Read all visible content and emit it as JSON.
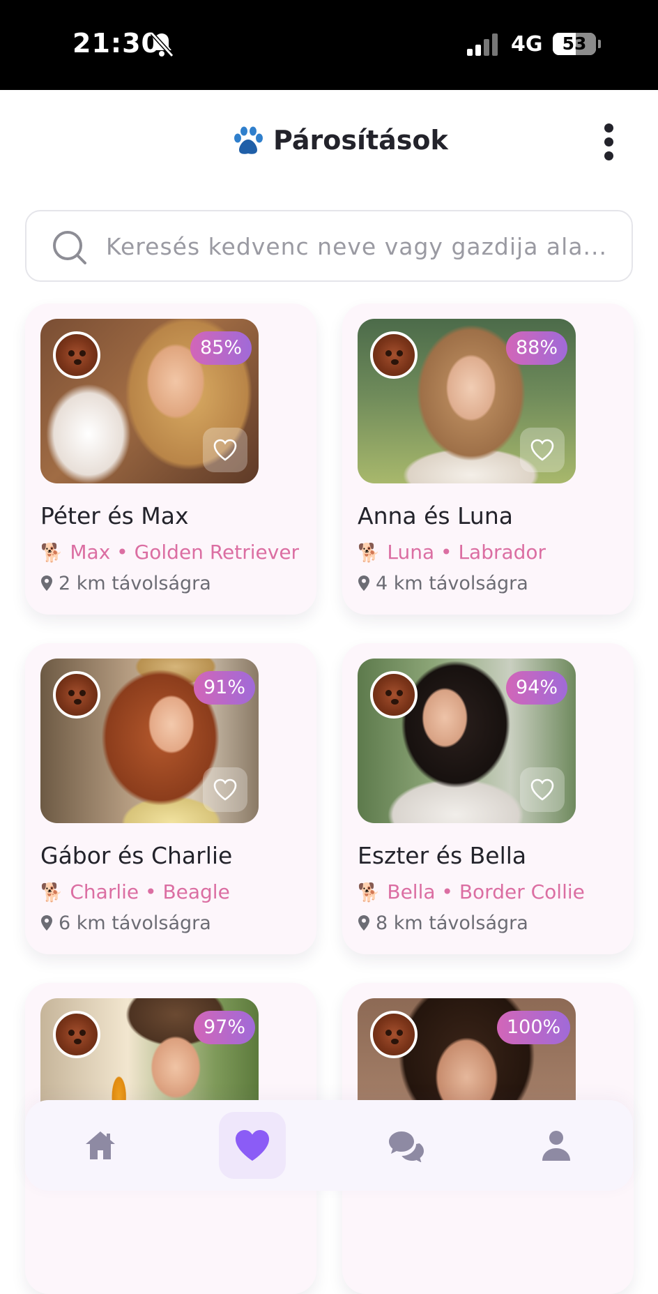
{
  "status_bar": {
    "time": "21:30",
    "network": "4G",
    "battery": "53",
    "icons": [
      "bell-slash-icon",
      "cellular-signal-icon",
      "battery-icon"
    ]
  },
  "header": {
    "title": "Párosítások",
    "icons": [
      "paw-icon",
      "more-vertical-icon"
    ]
  },
  "search": {
    "placeholder": "Keresés kedvenc neve vagy gazdija ala...",
    "value": ""
  },
  "matches": [
    {
      "name": "Péter és Max",
      "pet": "Max • Golden Retriever",
      "distance": "2 km távolságra",
      "match": "85%",
      "favorite": false
    },
    {
      "name": "Anna és Luna",
      "pet": "Luna • Labrador",
      "distance": "4 km távolságra",
      "match": "88%",
      "favorite": false
    },
    {
      "name": "Gábor és Charlie",
      "pet": "Charlie • Beagle",
      "distance": "6 km távolságra",
      "match": "91%",
      "favorite": false
    },
    {
      "name": "Eszter és Bella",
      "pet": "Bella • Border Collie",
      "distance": "8 km távolságra",
      "match": "94%",
      "favorite": false
    },
    {
      "match": "97%"
    },
    {
      "match": "100%"
    }
  ],
  "bottom_nav": {
    "items": [
      {
        "icon": "home-icon",
        "active": false
      },
      {
        "icon": "heart-icon",
        "active": true
      },
      {
        "icon": "chat-icon",
        "active": false
      },
      {
        "icon": "profile-icon",
        "active": false
      }
    ]
  },
  "colors": {
    "accent": "#8b5cf6",
    "pet_text": "#db6ea2",
    "badge_gradient_start": "#d266b8",
    "badge_gradient_end": "#a06ad8",
    "card_background": "#fdf6fb",
    "nav_icon": "#8e8aa3"
  }
}
